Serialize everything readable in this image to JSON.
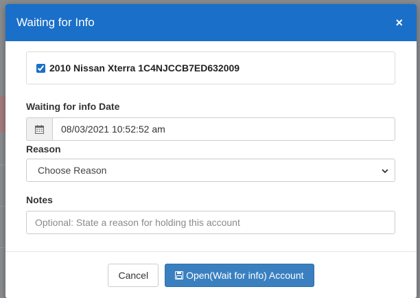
{
  "modal": {
    "title": "Waiting for Info",
    "close_symbol": "×"
  },
  "vehicle": {
    "checked": true,
    "label": "2010 Nissan Xterra 1C4NJCCB7ED632009"
  },
  "date_field": {
    "label": "Waiting for info Date",
    "value": "08/03/2021 10:52:52 am",
    "icon": "calendar-icon"
  },
  "reason_field": {
    "label": "Reason",
    "selected": "Choose Reason"
  },
  "notes_field": {
    "label": "Notes",
    "placeholder": "Optional: State a reason for holding this account"
  },
  "footer": {
    "cancel_label": "Cancel",
    "submit_label": "Open(Wait for info) Account"
  },
  "colors": {
    "header": "#1a6fc9",
    "primary_button": "#3a80c0"
  }
}
